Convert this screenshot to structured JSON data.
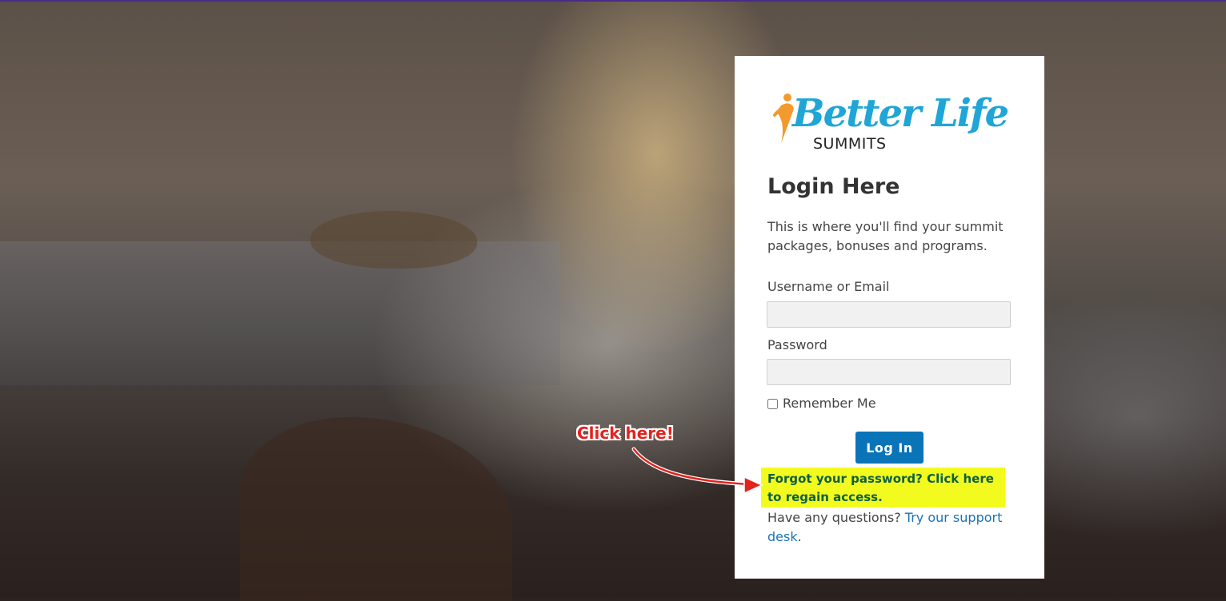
{
  "logo": {
    "brand_script": "Better Life",
    "brand_sub": "SUMMITS",
    "colors": {
      "script": "#1fa6d6",
      "figure_orange": "#f29a2e",
      "sub": "#222222"
    }
  },
  "login": {
    "title": "Login Here",
    "intro": "This is where you'll find your summit packages, bonuses and programs.",
    "username_label": "Username or Email",
    "username_value": "",
    "password_label": "Password",
    "password_value": "",
    "remember_label": "Remember Me",
    "remember_checked": false,
    "submit_label": "Log In",
    "forgot_text": "Forgot your password? Click here to regain access.",
    "questions_text": "Have any questions?",
    "support_link_text": "Try our support desk",
    "support_suffix": "."
  },
  "annotation": {
    "callout_text": "Click here!",
    "arrow_icon": "red-curved-arrow",
    "highlight_color": "#f3fb1e",
    "callout_color": "#e3231e"
  },
  "colors": {
    "primary_button": "#0a74b8",
    "link": "#1a73b5",
    "forgot_text": "#0b5f45"
  }
}
